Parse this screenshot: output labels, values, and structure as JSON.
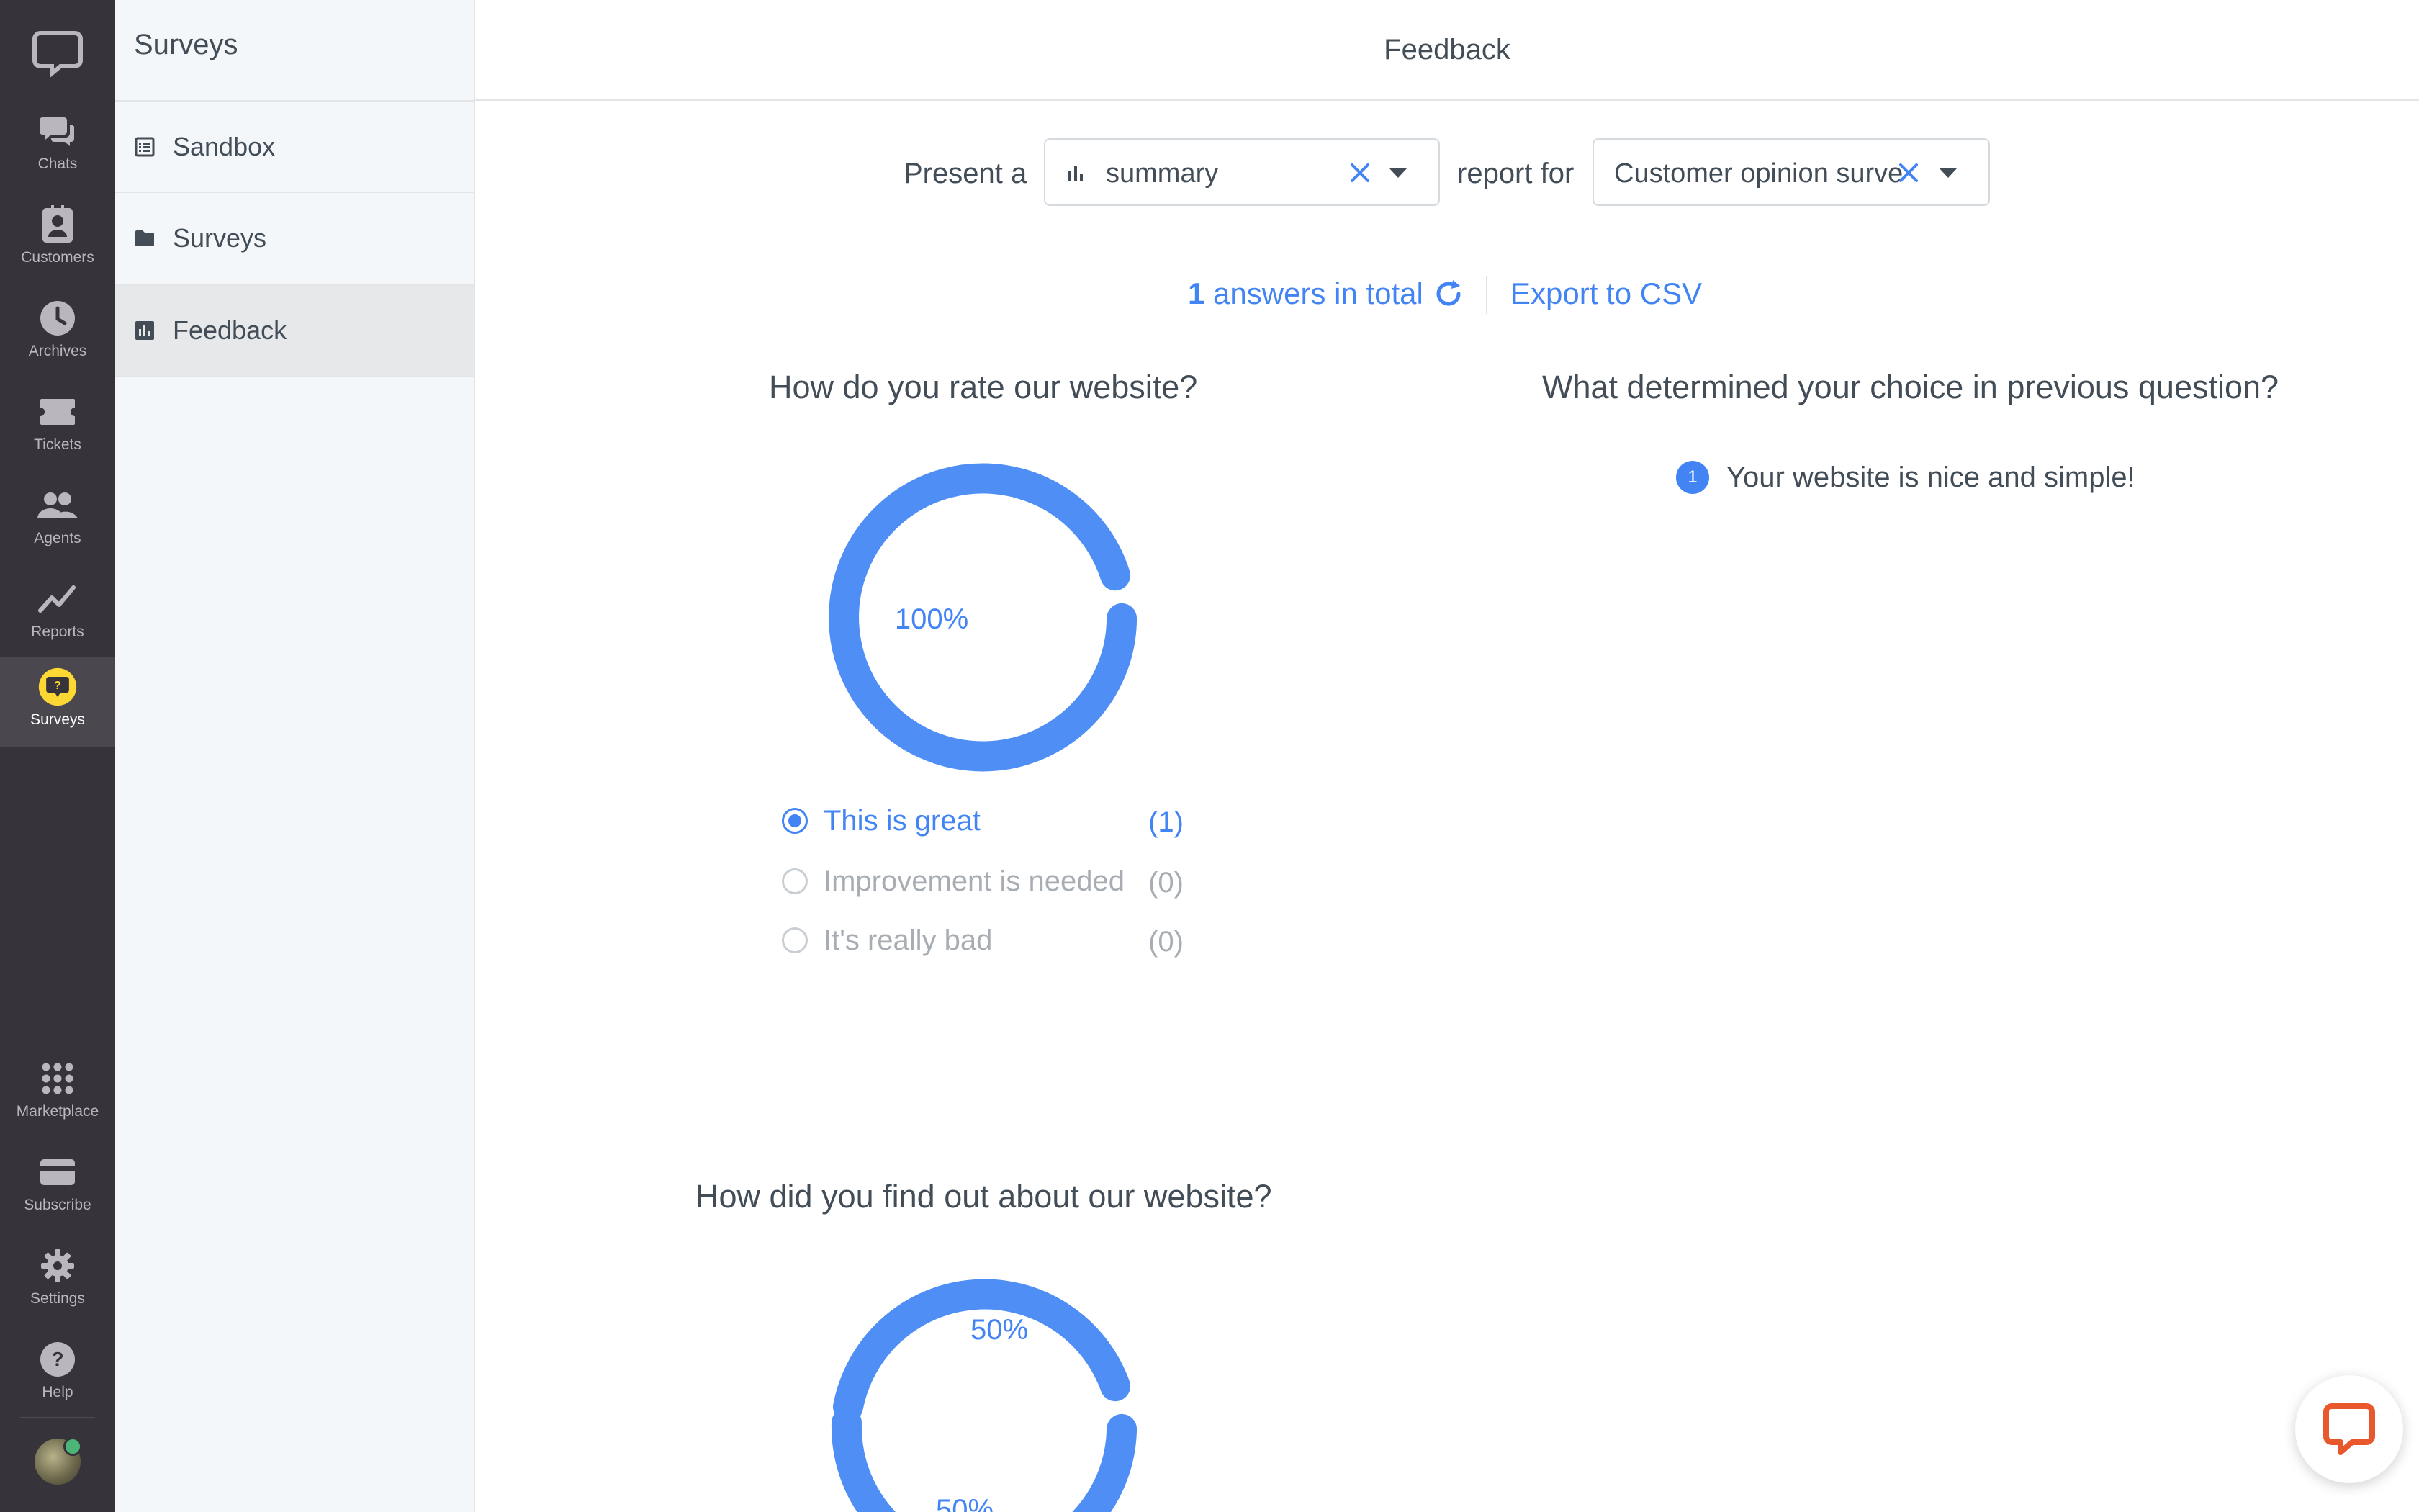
{
  "nav": {
    "items": [
      {
        "label": "Chats",
        "icon": "chat-bubbles-icon"
      },
      {
        "label": "Customers",
        "icon": "customers-icon"
      },
      {
        "label": "Archives",
        "icon": "clock-icon"
      },
      {
        "label": "Tickets",
        "icon": "ticket-icon"
      },
      {
        "label": "Agents",
        "icon": "people-icon"
      },
      {
        "label": "Reports",
        "icon": "line-chart-icon"
      },
      {
        "label": "Surveys",
        "icon": "survey-icon",
        "active": true
      }
    ],
    "bottom_items": [
      {
        "label": "Marketplace",
        "icon": "grid-icon"
      },
      {
        "label": "Subscribe",
        "icon": "card-icon"
      },
      {
        "label": "Settings",
        "icon": "gear-icon"
      },
      {
        "label": "Help",
        "icon": "help-icon"
      }
    ]
  },
  "sidebar": {
    "title": "Surveys",
    "items": [
      {
        "label": "Sandbox",
        "icon": "list-icon"
      },
      {
        "label": "Surveys",
        "icon": "folder-icon"
      },
      {
        "label": "Feedback",
        "icon": "bar-chart-icon",
        "active": true
      }
    ]
  },
  "header": {
    "title": "Feedback"
  },
  "controls": {
    "present_label": "Present a",
    "report_type": "summary",
    "report_for_label": "report for",
    "survey": "Customer opinion survey"
  },
  "summary": {
    "answers_count": "1",
    "answers_label": "answers in total",
    "export_label": "Export to CSV"
  },
  "questions": [
    {
      "title": "How do you rate our website?",
      "percent_label": "100%",
      "options": [
        {
          "label": "This is great",
          "count": "(1)",
          "selected": true
        },
        {
          "label": "Improvement is needed",
          "count": "(0)",
          "selected": false
        },
        {
          "label": "It's really bad",
          "count": "(0)",
          "selected": false
        }
      ]
    },
    {
      "title": "What determined your choice in previous question?",
      "answers": [
        {
          "index": "1",
          "text": "Your website is nice and simple!"
        }
      ]
    },
    {
      "title": "How did you find out about our website?",
      "percent_labels": [
        "50%",
        "50%"
      ]
    }
  ],
  "colors": {
    "accent": "#4384f5",
    "rail_bg": "#36333a",
    "sidebar_bg": "#f3f7f9",
    "survey_icon": "#fdd835",
    "chat_brand": "#e8582c"
  }
}
